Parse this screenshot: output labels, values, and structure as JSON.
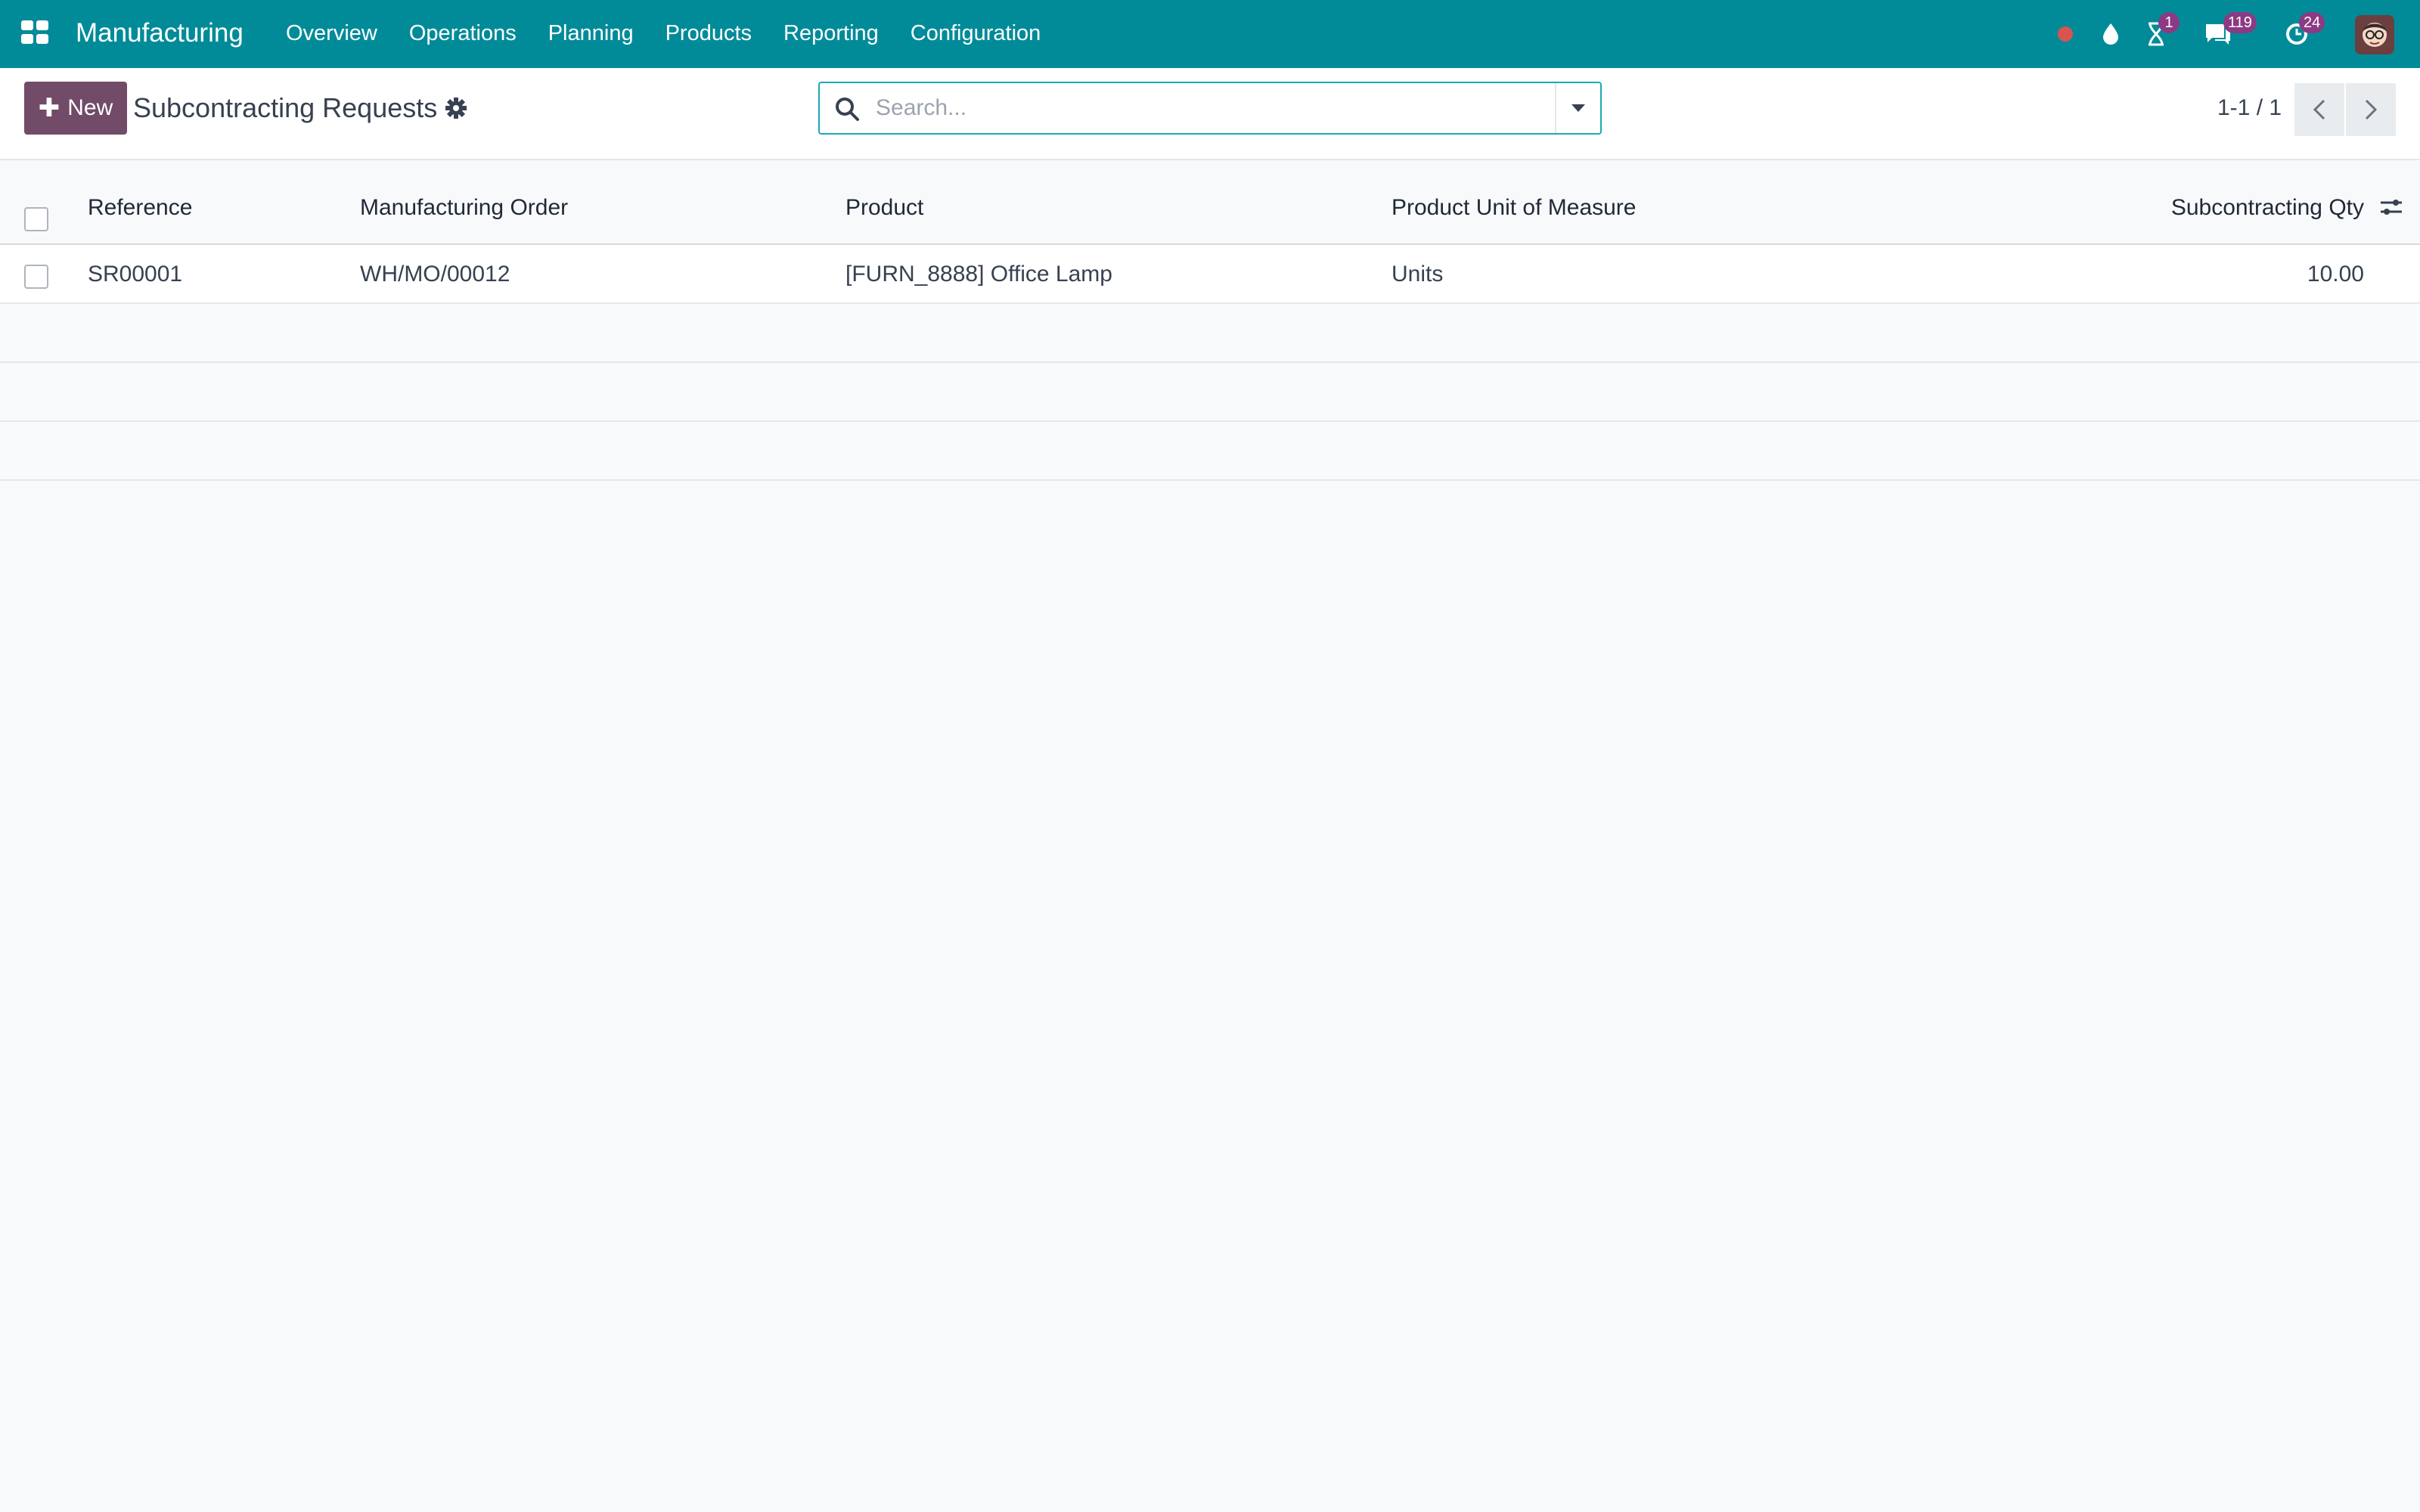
{
  "navbar": {
    "app_name": "Manufacturing",
    "menu": [
      "Overview",
      "Operations",
      "Planning",
      "Products",
      "Reporting",
      "Configuration"
    ],
    "badges": {
      "activities": "1",
      "messages": "119",
      "updates": "24"
    },
    "colors": {
      "navbar": "#018b99",
      "badge": "#8c3a83",
      "record_dot": "#d9534f"
    },
    "icons": [
      "apps-grid-icon",
      "record-dot-icon",
      "droplet-icon",
      "hourglass-icon",
      "chat-icon",
      "clock-refresh-icon",
      "user-avatar"
    ]
  },
  "control": {
    "new_label": "New",
    "title": "Subcontracting Requests",
    "search_placeholder": "Search...",
    "pager": "1-1 / 1"
  },
  "table": {
    "columns": [
      "Reference",
      "Manufacturing Order",
      "Product",
      "Product Unit of Measure",
      "Subcontracting Qty"
    ],
    "rows": [
      {
        "reference": "SR00001",
        "manufacturing_order": "WH/MO/00012",
        "product": "[FURN_8888] Office Lamp",
        "uom": "Units",
        "qty": "10.00"
      }
    ]
  },
  "accent_color": "#714b67"
}
